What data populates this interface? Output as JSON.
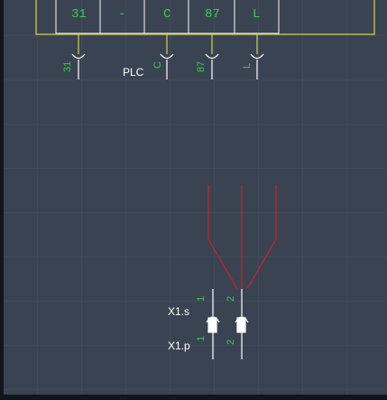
{
  "terminal_block": {
    "cells": [
      "31",
      "-",
      "C",
      "87",
      "L",
      ""
    ]
  },
  "connectors": {
    "pins": [
      "31",
      "C",
      "87",
      "L"
    ],
    "label": "PLC"
  },
  "plug": {
    "socket_label": "X1.s",
    "pin_label": "X1.p",
    "socket_pins": [
      "1",
      "2"
    ],
    "pin_pins": [
      "1",
      "2"
    ]
  },
  "colors": {
    "background": "#3a4352",
    "grid": "#404a5a",
    "wire_red": "#b8252c",
    "outline_yellow": "#d6d04a",
    "text_green": "#33d14a",
    "line_white": "#ffffff"
  }
}
